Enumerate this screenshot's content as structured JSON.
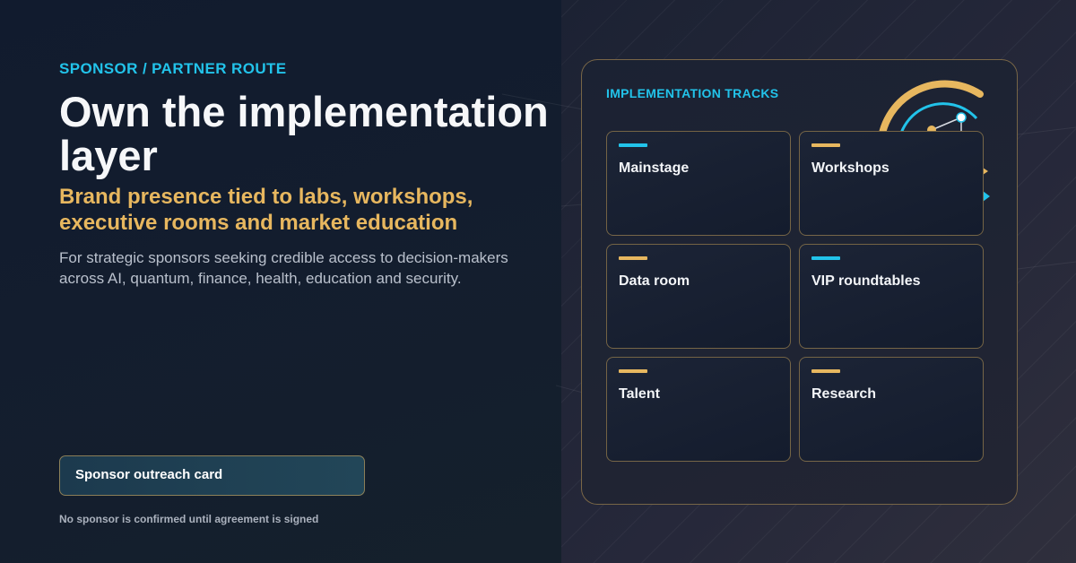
{
  "hero": {
    "eyebrow": "SPONSOR / PARTNER ROUTE",
    "headline": "Own the implementation layer",
    "subhead": "Brand presence tied to labs, workshops, executive rooms and market education",
    "body": "For strategic sponsors seeking credible access to decision-makers across AI, quantum, finance, health, education and security."
  },
  "cta": {
    "outreach_label": "Sponsor outreach card",
    "disclaimer": "No sponsor is confirmed until agreement is signed"
  },
  "panel": {
    "title": "IMPLEMENTATION TRACKS",
    "tracks": [
      {
        "label": "Mainstage",
        "accent": "#22c3ea"
      },
      {
        "label": "Workshops",
        "accent": "#e7b75f"
      },
      {
        "label": "Data room",
        "accent": "#e7b75f"
      },
      {
        "label": "VIP roundtables",
        "accent": "#22c3ea"
      },
      {
        "label": "Talent",
        "accent": "#e7b75f"
      },
      {
        "label": "Research",
        "accent": "#e7b75f"
      }
    ]
  },
  "colors": {
    "cyan": "#22c3ea",
    "gold": "#e7b75f",
    "background": "#121a2a"
  }
}
